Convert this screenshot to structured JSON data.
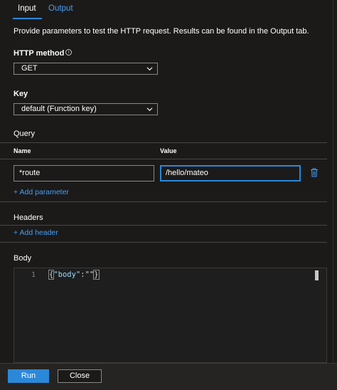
{
  "tabs": {
    "input_label": "Input",
    "output_label": "Output"
  },
  "description": "Provide parameters to test the HTTP request. Results can be found in the Output tab.",
  "http_method": {
    "label": "HTTP method",
    "info_icon": "i",
    "value": "GET"
  },
  "key": {
    "label": "Key",
    "value": "default (Function key)"
  },
  "query": {
    "title": "Query",
    "name_header": "Name",
    "value_header": "Value",
    "name_value": "*route",
    "value_value": "/hello/mateo",
    "add_label": "+ Add parameter"
  },
  "headers": {
    "title": "Headers",
    "add_label": "+ Add header"
  },
  "body": {
    "title": "Body",
    "line_number": "1",
    "code": {
      "open": "{",
      "key": "\"body\"",
      "colon": ":",
      "value": "\"\"",
      "close": "}"
    }
  },
  "footer": {
    "run_label": "Run",
    "close_label": "Close"
  },
  "colors": {
    "accent": "#2b88d8",
    "link": "#479ef5",
    "background": "#1b1a19"
  }
}
